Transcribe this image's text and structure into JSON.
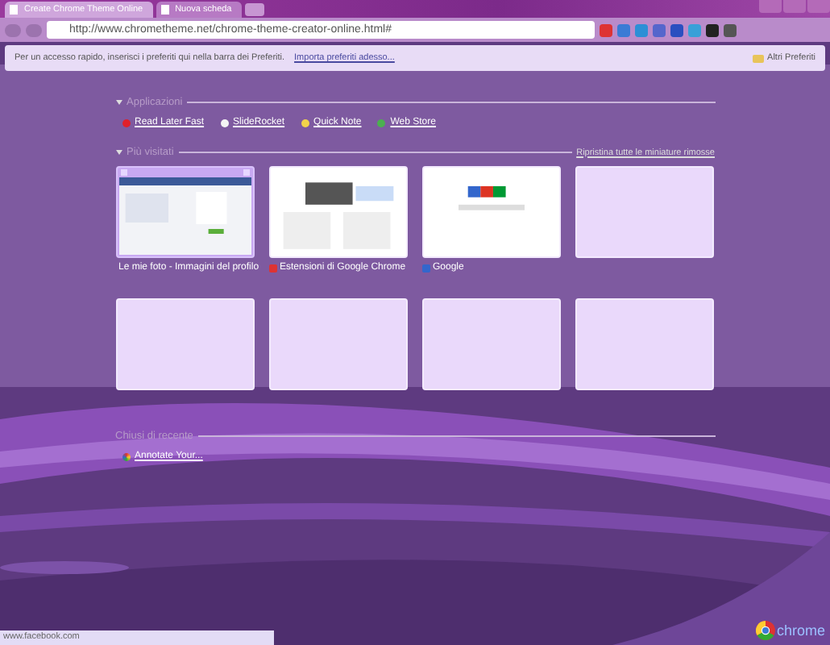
{
  "tabs": [
    {
      "title": "Create Chrome Theme Online",
      "selected": true
    },
    {
      "title": "Nuova scheda",
      "selected": false
    }
  ],
  "address": {
    "url": "http://www.chrometheme.net/chrome-theme-creator-online.html#"
  },
  "bookmarks_bar": {
    "message": "Per un accesso rapido, inserisci i preferiti qui nella barra dei Preferiti.",
    "link": "Importa preferiti adesso...",
    "other": "Altri Preferiti"
  },
  "apps": {
    "title": "Applicazioni",
    "items": [
      {
        "label": "Read Later Fast",
        "color": "#e0202a"
      },
      {
        "label": "SlideRocket",
        "color": "#f4f4f4"
      },
      {
        "label": "Quick Note",
        "color": "#f2d34a"
      },
      {
        "label": "Web Store",
        "color": "#4caf50"
      }
    ]
  },
  "most_visited": {
    "title": "Più visitati",
    "restore": "Ripristina tutte le miniature rimosse",
    "tiles": [
      {
        "kind": "facebook",
        "label": "Le mie foto - Immagini del profilo",
        "hovered": true
      },
      {
        "kind": "chrome",
        "label": "Estensioni di Google Chrome",
        "hovered": false
      },
      {
        "kind": "google",
        "label": "Google",
        "hovered": false
      },
      {
        "kind": "empty",
        "hovered": false
      },
      {
        "kind": "empty",
        "hovered": false
      },
      {
        "kind": "empty",
        "hovered": false
      },
      {
        "kind": "empty",
        "hovered": false
      },
      {
        "kind": "empty",
        "hovered": false
      }
    ]
  },
  "recently_closed": {
    "title": "Chiusi di recente",
    "items": [
      "Annotate Your..."
    ]
  },
  "status_bubble": "www.facebook.com",
  "logo": "chrome"
}
